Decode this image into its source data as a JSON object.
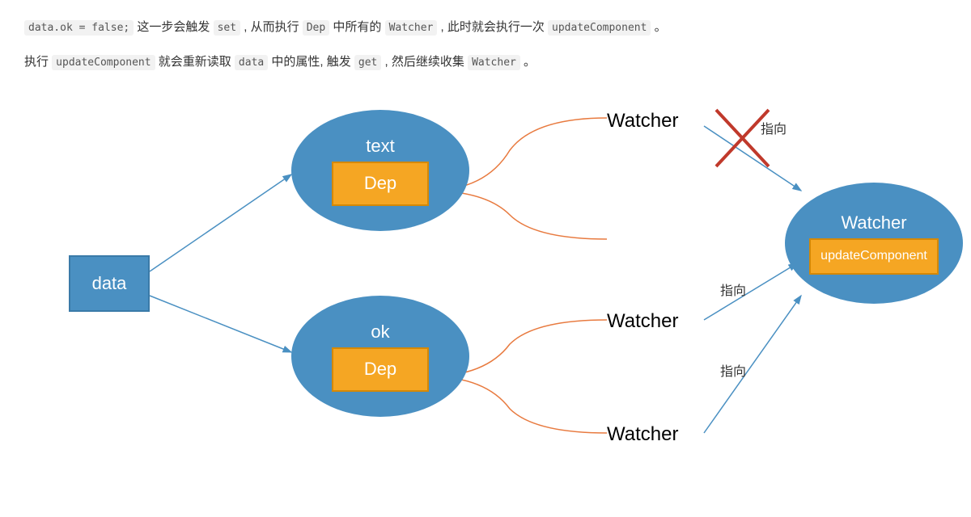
{
  "paragraphs": {
    "p1_code1": "data.ok = false;",
    "p1_text1": " 这一步会触发 ",
    "p1_code2": "set",
    "p1_text2": " , 从而执行 ",
    "p1_code3": "Dep",
    "p1_text3": " 中所有的 ",
    "p1_code4": "Watcher",
    "p1_text4": " , 此时就会执行一次 ",
    "p1_code5": "updateComponent",
    "p1_text5": " 。",
    "p2_text1": "执行 ",
    "p2_code1": "updateComponent",
    "p2_text2": " 就会重新读取 ",
    "p2_code2": "data",
    "p2_text3": " 中的属性, 触发 ",
    "p2_code3": "get",
    "p2_text4": " , 然后继续收集 ",
    "p2_code4": "Watcher",
    "p2_text5": " 。"
  },
  "diagram": {
    "data_label": "data",
    "text_label": "text",
    "ok_label": "ok",
    "dep_label": "Dep",
    "watcher_label": "Watcher",
    "update_component_label": "updateComponent",
    "point_to_label": "指向"
  }
}
